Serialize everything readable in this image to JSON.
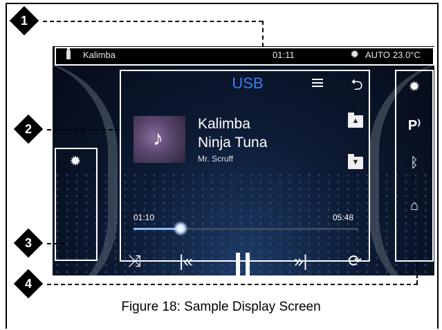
{
  "status_bar": {
    "source_name": "Kalimba",
    "clock": "01:11",
    "climate_mode": "AUTO",
    "temperature": "23.0°C"
  },
  "player": {
    "source_label": "USB",
    "track_title": "Kalimba",
    "album": "Ninja Tuna",
    "artist": "Mr. Scruff",
    "elapsed": "01:10",
    "duration": "05:48",
    "progress_fraction": 0.21
  },
  "callouts": [
    "1",
    "2",
    "3",
    "4"
  ],
  "caption": "Figure 18: Sample Display Screen",
  "colors": {
    "accent": "#3c7ff2",
    "screen_bg": "#0c1a33",
    "status_bg": "#000000"
  },
  "icons": {
    "list": "list-icon",
    "back": "back-arrow-icon",
    "folder_up": "folder-up-icon",
    "folder_down": "folder-down-icon",
    "shuffle": "shuffle-icon",
    "previous": "previous-track-icon",
    "pause": "pause-icon",
    "next": "next-track-icon",
    "repeat": "repeat-icon",
    "settings": "gear-icon",
    "parking": "parking-sensor-icon",
    "bluetooth": "bluetooth-icon",
    "home": "home-icon",
    "usb": "usb-icon"
  }
}
